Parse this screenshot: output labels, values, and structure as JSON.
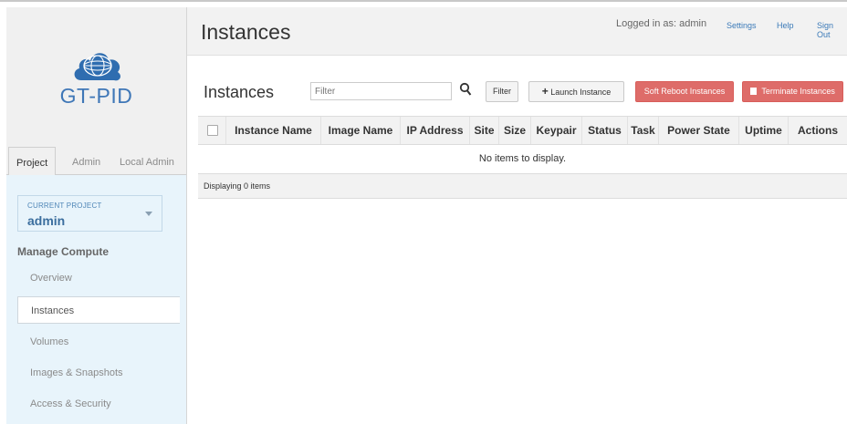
{
  "brand": {
    "name": "GT-PID"
  },
  "header": {
    "title": "Instances",
    "logged_in": "Logged in as: admin",
    "links": {
      "settings": "Settings",
      "help": "Help",
      "signout": "Sign Out"
    }
  },
  "sidebar": {
    "tabs": {
      "project": "Project",
      "admin": "Admin",
      "local_admin": "Local Admin"
    },
    "current_project_label": "CURRENT PROJECT",
    "current_project": "admin",
    "section": "Manage Compute",
    "items": [
      {
        "label": "Overview"
      },
      {
        "label": "Instances"
      },
      {
        "label": "Volumes"
      },
      {
        "label": "Images & Snapshots"
      },
      {
        "label": "Access & Security"
      }
    ]
  },
  "main": {
    "section_title": "Instances",
    "filter_placeholder": "Filter",
    "filter_button": "Filter",
    "launch_button": "Launch Instance",
    "soft_reboot_button": "Soft Reboot Instances",
    "terminate_button": "Terminate Instances",
    "columns": [
      "Instance Name",
      "Image Name",
      "IP Address",
      "Site",
      "Size",
      "Keypair",
      "Status",
      "Task",
      "Power State",
      "Uptime",
      "Actions"
    ],
    "empty_message": "No items to display.",
    "footer": "Displaying 0 items"
  },
  "colors": {
    "brand": "#3f77b7",
    "danger": "#d9534f",
    "link": "#3b7ab8"
  }
}
